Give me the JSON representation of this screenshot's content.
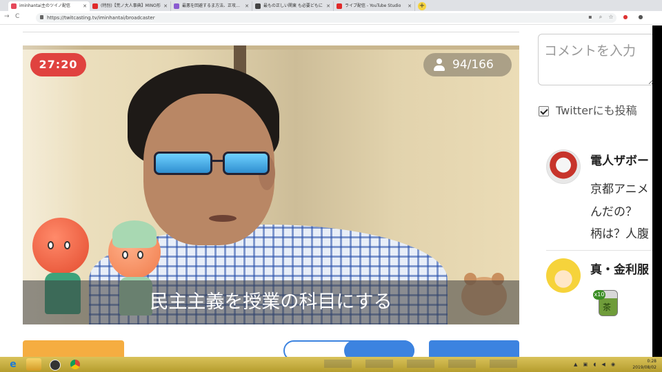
{
  "browser": {
    "tabs": [
      {
        "title": "iminhantai主のツイノ配信",
        "favicon_color": "#e5485a",
        "active": true
      },
      {
        "title": "(特別)【荒ノ大人事典】MINO形",
        "favicon_color": "#e02a2a",
        "active": false
      },
      {
        "title": "最悪を回避するま方法、正攻法に",
        "favicon_color": "#8a5bd0",
        "active": false
      },
      {
        "title": "最もの正しい関東 も必要どもに",
        "favicon_color": "#444444",
        "active": false
      },
      {
        "title": "ライブ配信 - YouTube Studio",
        "favicon_color": "#e02a2a",
        "active": false
      }
    ],
    "new_tab_label": "+",
    "url": "https://twitcasting.tv/iminhantai/broadcaster"
  },
  "stream": {
    "timer": "27:20",
    "viewers": "94/166",
    "caption": "民主主義を授業の科目にする"
  },
  "side_panel": {
    "comment_placeholder": "コメントを入力",
    "twitter_label": "Twitterにも投稿",
    "comments": [
      {
        "name": "電人ザボー",
        "lines": [
          "京都アニメ",
          "んだの？",
          "柄は？人腹"
        ]
      },
      {
        "name": "真・金利服",
        "stamp_kanji": "茶",
        "stamp_badge": "x10",
        "line": "［"
      }
    ]
  },
  "taskbar": {
    "ie_glyph": "e",
    "tray_icons": "▲ ▣ ◖ ◀ ◉",
    "time": "0:28",
    "date": "2019/08/02"
  }
}
